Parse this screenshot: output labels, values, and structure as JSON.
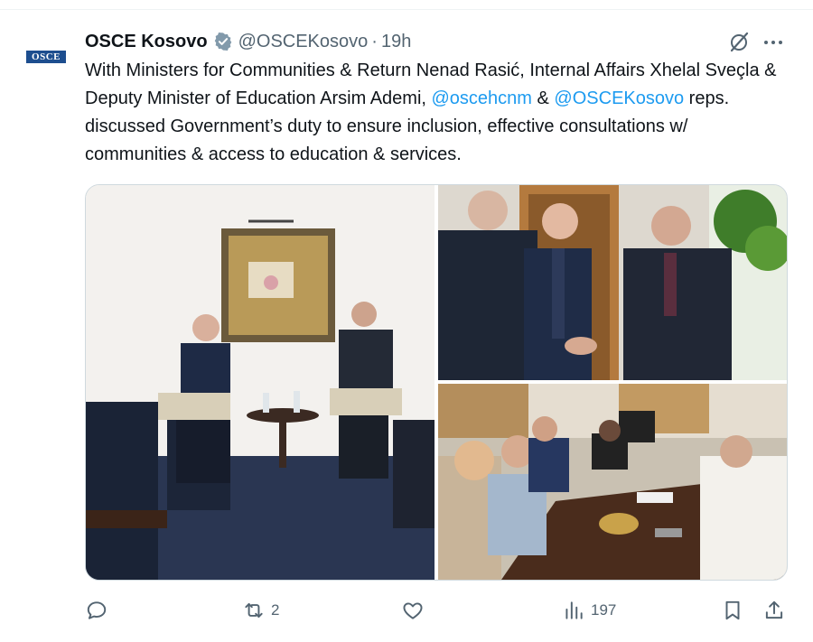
{
  "tweet": {
    "author_name": "OSCE Kosovo",
    "handle": "@OSCEKosovo",
    "separator": "·",
    "time": "19h",
    "avatar_text": "OSCE",
    "text_part1": "With Ministers for Communities & Return Nenad Rasić, Internal Affairs Xhelal Sveçla & Deputy Minister of Education Arsim Ademi, ",
    "mention1": "@oscehcnm",
    "text_part2": " & ",
    "mention2": "@OSCEKosovo",
    "text_part3": " reps. discussed Government’s duty to ensure inclusion, effective consultations w/ communities & access to education & services."
  },
  "actions": {
    "replies": "",
    "reposts": "2",
    "likes": "",
    "views": "197"
  },
  "colors": {
    "accent": "#1d9bf0",
    "muted": "#536471",
    "text": "#0f1419",
    "border": "#cfd9de"
  },
  "icons": [
    "verified-badge-icon",
    "grok-icon",
    "more-icon",
    "reply-icon",
    "repost-icon",
    "like-icon",
    "views-icon",
    "bookmark-icon",
    "share-icon"
  ]
}
